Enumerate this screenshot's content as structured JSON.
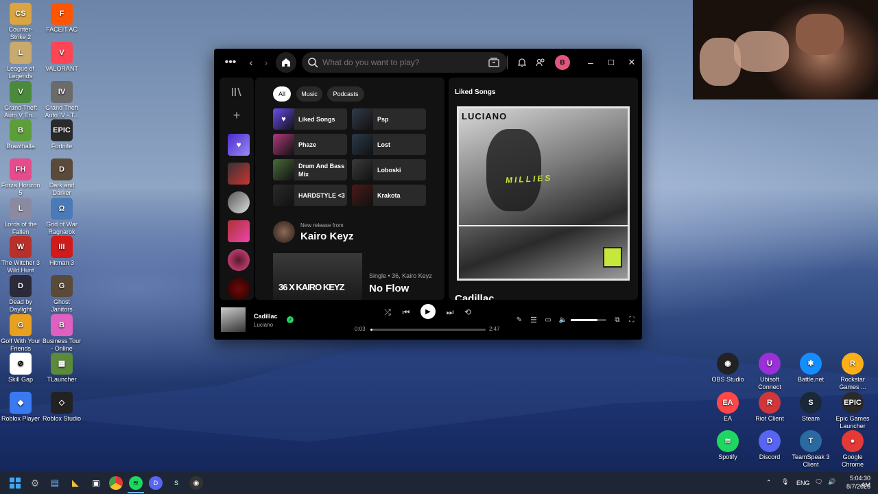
{
  "desktop_left": [
    {
      "label": "Counter-Strike 2",
      "color": "#d9a441",
      "glyph": "CS"
    },
    {
      "label": "FACEIT AC",
      "color": "#ff5500",
      "glyph": "F"
    },
    {
      "label": "League of Legends",
      "color": "#c8aa6e",
      "glyph": "L"
    },
    {
      "label": "VALORANT",
      "color": "#fd4556",
      "glyph": "V"
    },
    {
      "label": "Grand Theft Auto V En...",
      "color": "#4b8a3c",
      "glyph": "V"
    },
    {
      "label": "Grand Theft Auto IV - T...",
      "color": "#6b6b6b",
      "glyph": "IV"
    },
    {
      "label": "Brawlhalla",
      "color": "#5c9e3a",
      "glyph": "B"
    },
    {
      "label": "Fortnite",
      "color": "#2a2a2a",
      "glyph": "EPIC"
    },
    {
      "label": "Forza Horizon 5",
      "color": "#e64b8c",
      "glyph": "FH"
    },
    {
      "label": "Dark and Darker",
      "color": "#5a4a3a",
      "glyph": "D"
    },
    {
      "label": "Lords of the Fallen",
      "color": "#8a8aa0",
      "glyph": "L"
    },
    {
      "label": "God of War Ragnarok",
      "color": "#4a7ab8",
      "glyph": "Ω"
    },
    {
      "label": "The Witcher 3 Wild Hunt",
      "color": "#b8302a",
      "glyph": "W"
    },
    {
      "label": "Hitman 3",
      "color": "#d11a1a",
      "glyph": "III"
    },
    {
      "label": "Dead by Daylight",
      "color": "#2a2a3a",
      "glyph": "D"
    },
    {
      "label": "Ghost Janitors",
      "color": "#5a4a3a",
      "glyph": "G"
    },
    {
      "label": "Golf With Your Friends",
      "color": "#e8a020",
      "glyph": "G"
    },
    {
      "label": "Business Tour - Online Multi...",
      "color": "#e060c0",
      "glyph": "B"
    },
    {
      "label": "Skill Gap",
      "color": "#ffffff",
      "glyph": "⊘"
    },
    {
      "label": "TLauncher",
      "color": "#5a8a3a",
      "glyph": "▦"
    },
    {
      "label": "Roblox Player",
      "color": "#3a7af0",
      "glyph": "◆"
    },
    {
      "label": "Roblox Studio",
      "color": "#222222",
      "glyph": "◇"
    }
  ],
  "desktop_right": [
    {
      "label": "OBS Studio",
      "color": "#222222",
      "glyph": "◉"
    },
    {
      "label": "Ubisoft Connect",
      "color": "#9b30d9",
      "glyph": "U"
    },
    {
      "label": "Battle.net",
      "color": "#148eff",
      "glyph": "✱"
    },
    {
      "label": "Rockstar Games ...",
      "color": "#fcaf17",
      "glyph": "R"
    },
    {
      "label": "EA",
      "color": "#ff4747",
      "glyph": "EA"
    },
    {
      "label": "Riot Client",
      "color": "#d13639",
      "glyph": "R"
    },
    {
      "label": "Steam",
      "color": "#1b2838",
      "glyph": "S"
    },
    {
      "label": "Epic Games Launcher",
      "color": "#2a2a2a",
      "glyph": "EPIC"
    },
    {
      "label": "Spotify",
      "color": "#1ed760",
      "glyph": "≋"
    },
    {
      "label": "Discord",
      "color": "#5865f2",
      "glyph": "D"
    },
    {
      "label": "TeamSpeak 3 Client",
      "color": "#2a6aa0",
      "glyph": "T"
    },
    {
      "label": "Google Chrome",
      "color": "#e53935",
      "glyph": "●"
    }
  ],
  "spotify": {
    "search_placeholder": "What do you want to play?",
    "avatar_letter": "B",
    "filters": [
      "All",
      "Music",
      "Podcasts"
    ],
    "shortcuts": [
      {
        "label": "Liked Songs",
        "color": "#6a4cf0"
      },
      {
        "label": "Psp",
        "color": "#333a48"
      },
      {
        "label": "Phaze",
        "color": "#b03a7a"
      },
      {
        "label": "Lost",
        "color": "#2a3a4a"
      },
      {
        "label": "Drum And Bass Mix",
        "color": "#4a6a3a"
      },
      {
        "label": "Loboski",
        "color": "#3a3a3a"
      },
      {
        "label": "HARDSTYLE <3",
        "color": "#2a2a2a"
      },
      {
        "label": "Krakota",
        "color": "#4a1a1a"
      }
    ],
    "new_release_caption": "New release from",
    "new_release_artist": "Kairo Keyz",
    "single_meta": "Single • 36, Kairo Keyz",
    "single_title": "No Flow",
    "single_cover_text": "36 X KAIRO KEYZ",
    "right_panel_title": "Liked Songs",
    "cover_artist": "LUCIANO",
    "cover_title": "MILLIES",
    "right_song_title": "Cadillac",
    "now_playing_title": "Cadillac",
    "now_playing_artist": "Luciano",
    "time_elapsed": "0:03",
    "time_total": "2:47",
    "progress": 0.02,
    "volume": 0.75
  },
  "webcam": {
    "present": true
  },
  "taskbar": {
    "apps": [
      "windows",
      "settings",
      "notepad",
      "explorer",
      "store",
      "chrome",
      "spotify",
      "discord",
      "steam",
      "obs"
    ],
    "lang": "ENG",
    "time": "5:04:30 AM",
    "date": "8/7/2026"
  }
}
